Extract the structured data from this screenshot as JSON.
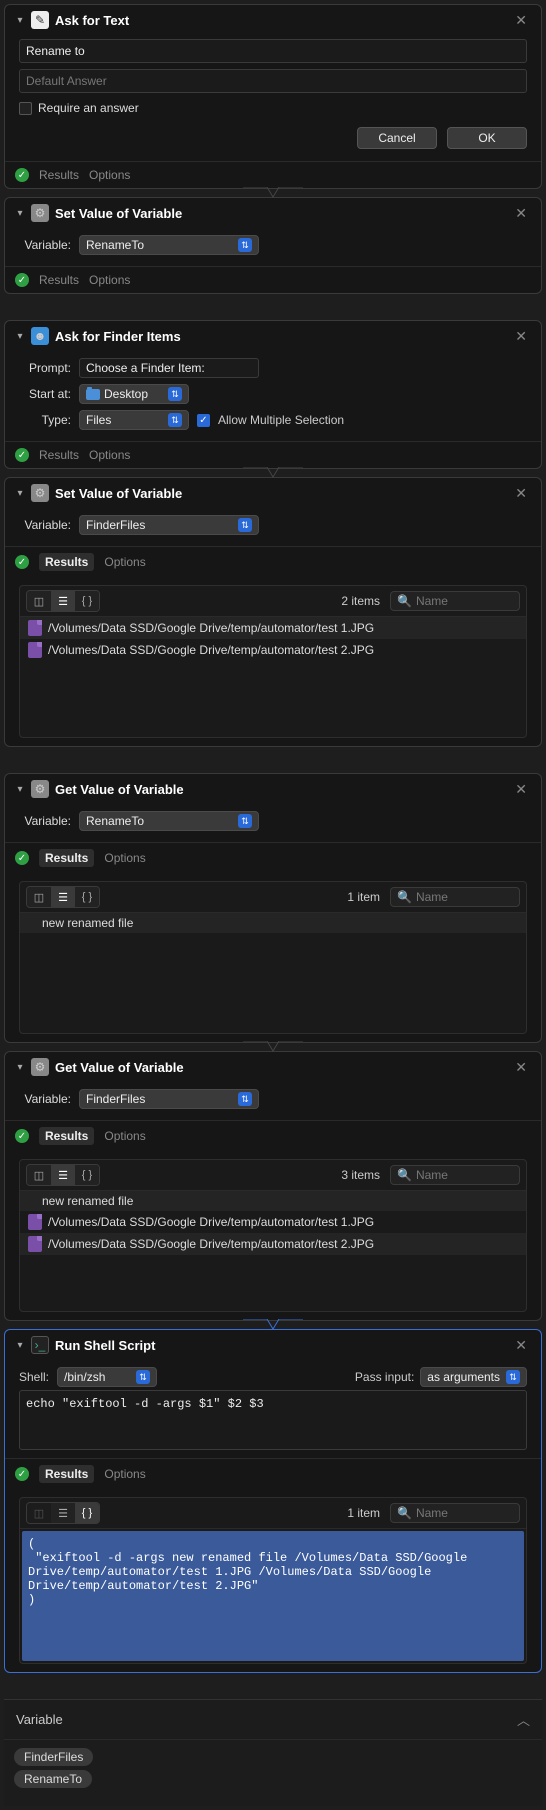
{
  "actions": {
    "ask_text": {
      "title": "Ask for Text",
      "question": "Rename to",
      "default_placeholder": "Default Answer",
      "require_label": "Require an answer",
      "cancel": "Cancel",
      "ok": "OK"
    },
    "set_var1": {
      "title": "Set Value of Variable",
      "label": "Variable:",
      "value": "RenameTo"
    },
    "ask_finder": {
      "title": "Ask for Finder Items",
      "prompt_label": "Prompt:",
      "prompt_value": "Choose a Finder Item:",
      "startat_label": "Start at:",
      "startat_value": "Desktop",
      "type_label": "Type:",
      "type_value": "Files",
      "allow_multi": "Allow Multiple Selection"
    },
    "set_var2": {
      "title": "Set Value of Variable",
      "label": "Variable:",
      "value": "FinderFiles",
      "results": {
        "count": "2 items",
        "search_ph": "Name",
        "rows": [
          "/Volumes/Data SSD/Google Drive/temp/automator/test 1.JPG",
          "/Volumes/Data SSD/Google Drive/temp/automator/test 2.JPG"
        ]
      }
    },
    "get_var1": {
      "title": "Get Value of Variable",
      "label": "Variable:",
      "value": "RenameTo",
      "results": {
        "count": "1 item",
        "search_ph": "Name",
        "rows": [
          "new renamed file"
        ]
      }
    },
    "get_var2": {
      "title": "Get Value of Variable",
      "label": "Variable:",
      "value": "FinderFiles",
      "results": {
        "count": "3 items",
        "search_ph": "Name",
        "rows_text": [
          "new renamed file"
        ],
        "rows_file": [
          "/Volumes/Data SSD/Google Drive/temp/automator/test 1.JPG",
          "/Volumes/Data SSD/Google Drive/temp/automator/test 2.JPG"
        ]
      }
    },
    "shell": {
      "title": "Run Shell Script",
      "shell_label": "Shell:",
      "shell_value": "/bin/zsh",
      "pass_label": "Pass input:",
      "pass_value": "as arguments",
      "code": "echo \"exiftool -d -args $1\" $2 $3",
      "results": {
        "count": "1 item",
        "search_ph": "Name",
        "output": "(\n \"exiftool -d -args new renamed file /Volumes/Data SSD/Google Drive/temp/automator/test 1.JPG /Volumes/Data SSD/Google Drive/temp/automator/test 2.JPG\"\n)"
      }
    }
  },
  "footer": {
    "results": "Results",
    "options": "Options"
  },
  "variables": {
    "header": "Variable",
    "items": [
      "FinderFiles",
      "RenameTo"
    ]
  }
}
